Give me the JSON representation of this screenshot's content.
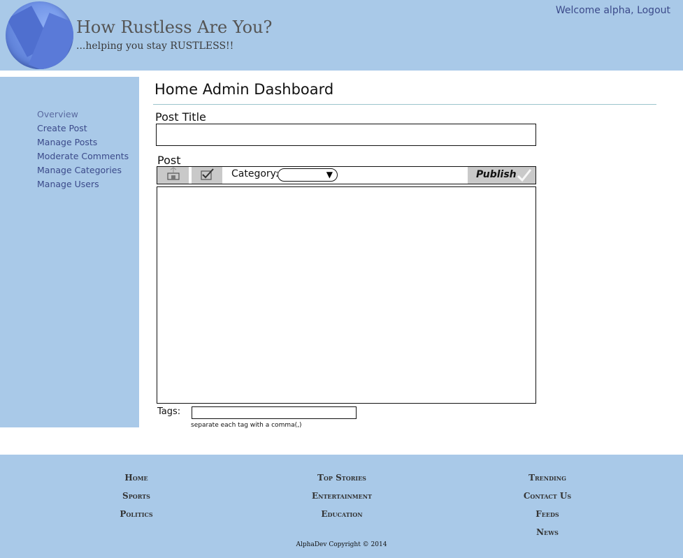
{
  "header": {
    "site_title": "How Rustless Are You?",
    "tagline": "...helping you stay RUSTLESS!!",
    "welcome": "Welcome alpha,",
    "logout": "Logout"
  },
  "sidebar": {
    "items": [
      {
        "label": "Overview"
      },
      {
        "label": "Create Post"
      },
      {
        "label": "Manage Posts"
      },
      {
        "label": "Moderate Comments"
      },
      {
        "label": "Manage Categories"
      },
      {
        "label": "Manage Users"
      }
    ]
  },
  "main": {
    "title": "Home Admin Dashboard",
    "post_title_label": "Post Title",
    "post_title_value": "",
    "post_label": "Post",
    "category_label": "Category:",
    "category_value": "",
    "publish_label": "Publish",
    "tags_label": "Tags:",
    "tags_value": "",
    "tags_hint": "separate each tag with a comma(,)"
  },
  "footer": {
    "col1": [
      "Home",
      "Sports",
      "Politics"
    ],
    "col2": [
      "Top Stories",
      "Entertainment",
      "Education"
    ],
    "col3": [
      "Trending",
      "Contact Us",
      "Feeds",
      "News"
    ],
    "copyright": "AlphaDev Copyright © 2014"
  },
  "colors": {
    "panel_blue": "#a9c9e8",
    "link_blue": "#3b4a8a",
    "button_gray": "#c9c9c9"
  }
}
